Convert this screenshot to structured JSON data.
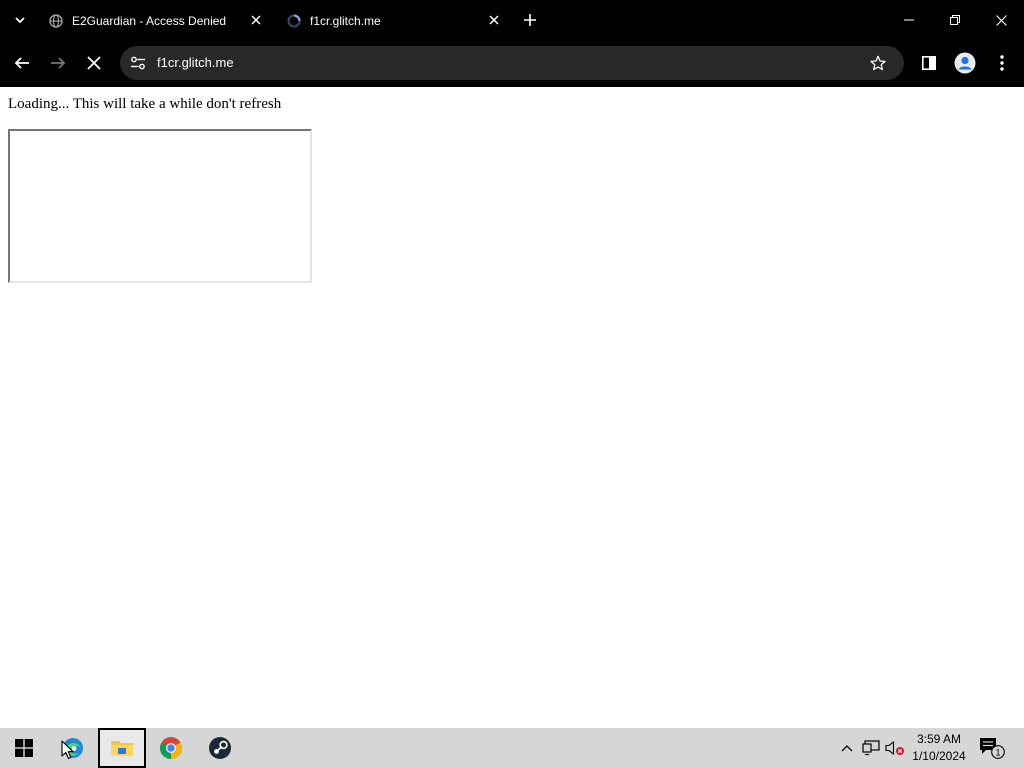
{
  "tabs": [
    {
      "title": "E2Guardian - Access Denied",
      "icon": "globe-icon"
    },
    {
      "title": "f1cr.glitch.me",
      "icon": "loading-favicon-icon"
    }
  ],
  "toolbar": {
    "url": "f1cr.glitch.me"
  },
  "page": {
    "loading_text": "Loading... This will take a while don't refresh"
  },
  "taskbar": {
    "apps": [
      "start-icon",
      "edge-icon",
      "file-explorer-icon",
      "chrome-icon",
      "steam-icon"
    ],
    "clock_time": "3:59 AM",
    "clock_date": "1/10/2024",
    "notification_count": "1"
  },
  "colors": {
    "chrome_dark": "#000000",
    "omnibox": "#282828",
    "taskbar": "#d6d6d6"
  }
}
